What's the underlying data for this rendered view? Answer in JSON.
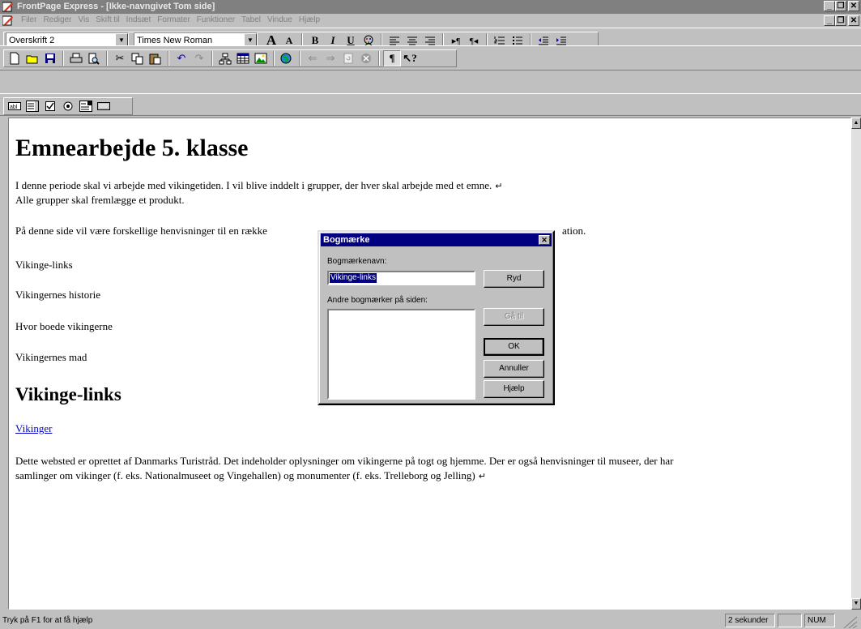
{
  "window": {
    "title": "FrontPage Express - [Ikke-navngivet Tom side]",
    "minimize": "_",
    "restore": "❐",
    "close": "✕"
  },
  "menu": [
    "Filer",
    "Rediger",
    "Vis",
    "Skift til",
    "Indsæt",
    "Formater",
    "Funktioner",
    "Tabel",
    "Vindue",
    "Hjælp"
  ],
  "format_toolbar": {
    "style_value": "Overskrift 2",
    "font_value": "Times New Roman"
  },
  "document": {
    "heading": "Emnearbejde 5. klasse",
    "intro_line1": "I denne periode skal vi arbejde med vikingetiden. I vil blive inddelt i grupper, der hver skal arbejde med et emne.",
    "intro_line2": "Alle grupper skal fremlægge et produkt.",
    "info_line_left": "På denne side vil være forskellige henvisninger til en række",
    "info_line_right": "ation.",
    "toc": [
      "Vikinge-links",
      "Vikingernes historie",
      "Hvor boede vikingerne",
      "Vikingernes mad"
    ],
    "section_heading": "Vikinge-links",
    "link_text": "Vikinger",
    "desc_line1": "Dette websted er oprettet af Danmarks Turistråd. Det indeholder oplysninger om vikingerne på togt og hjemme. Der er også henvisninger til museer, der har",
    "desc_line2": "samlinger om vikinger (f. eks. Nationalmuseet og Vingehallen) og monumenter (f. eks. Trelleborg og Jelling)",
    "return_mark": "↵"
  },
  "dialog": {
    "title": "Bogmærke",
    "name_label": "Bogmærkenavn:",
    "name_value": "Vikinge-links",
    "other_label": "Andre bogmærker på siden:",
    "buttons": {
      "clear": "Ryd",
      "goto": "Gå til",
      "ok": "OK",
      "cancel": "Annuller",
      "help": "Hjælp"
    }
  },
  "status": {
    "message": "Tryk på F1 for at få hjælp",
    "time": "2 sekunder",
    "num": "NUM"
  }
}
